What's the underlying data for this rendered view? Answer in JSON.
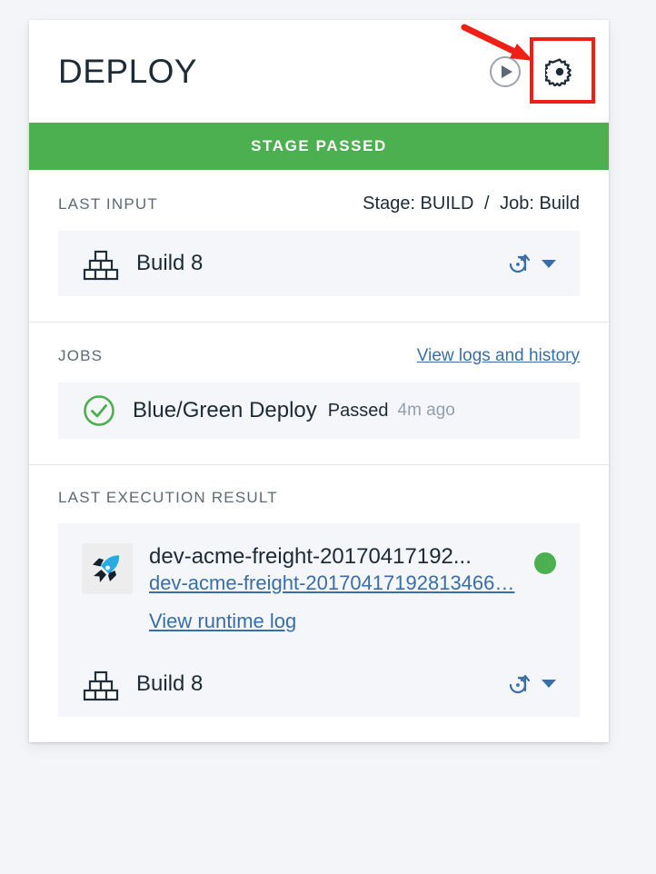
{
  "header": {
    "title": "DEPLOY",
    "run_icon": "play-circle-icon",
    "settings_icon": "gear-icon"
  },
  "status_banner": {
    "text": "STAGE PASSED",
    "color": "#4caf50"
  },
  "last_input": {
    "label": "LAST INPUT",
    "stage_label": "Stage: BUILD",
    "separator": "/",
    "job_label": "Job: Build",
    "artifact": {
      "icon": "build-blocks-icon",
      "name": "Build 8",
      "action_icon": "promote-arrow-icon",
      "caret_icon": "chevron-down-icon"
    }
  },
  "jobs": {
    "label": "JOBS",
    "link": "View logs and history",
    "items": [
      {
        "icon": "check-circle-icon",
        "name": "Blue/Green Deploy",
        "status": "Passed",
        "time": "4m ago",
        "status_color": "#4caf50"
      }
    ]
  },
  "last_execution_result": {
    "label": "LAST EXECUTION RESULT",
    "app": {
      "icon": "rocket-icon",
      "title": "dev-acme-freight-20170417192...",
      "link": "dev-acme-freight-20170417192813466…",
      "runtime_link": "View runtime log",
      "status_indicator": "green-dot",
      "status_color": "#4caf50"
    },
    "artifact": {
      "icon": "build-blocks-icon",
      "name": "Build 8",
      "action_icon": "promote-arrow-icon",
      "caret_icon": "chevron-down-icon"
    }
  },
  "annotation": {
    "highlight_color": "#ee2016",
    "target": "gear-icon"
  }
}
